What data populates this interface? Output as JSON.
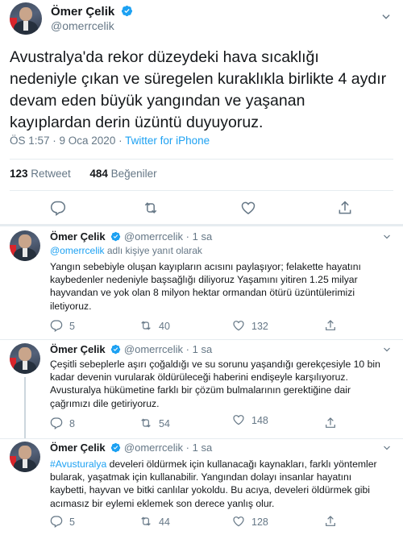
{
  "main": {
    "name": "Ömer Çelik",
    "handle": "@omerrcelik",
    "text": "Avustralya'da rekor düzeydeki hava sıcaklığı nedeniyle çıkan ve süregelen kuraklıkla birlikte 4 aydır devam eden büyük yangından ve yaşanan kayıplardan derin üzüntü duyuyoruz.",
    "time": "ÖS 1:57 · 9 Oca 2020 · ",
    "source": "Twitter for iPhone",
    "retweets": "123",
    "retweets_label": " Retweet",
    "likes": "484",
    "likes_label": " Beğeniler"
  },
  "replies": [
    {
      "name": "Ömer Çelik",
      "handle": "@omerrcelik",
      "time": " · 1 sa",
      "replying_mention": "@omerrcelik",
      "replying_rest": " adlı kişiye yanıt olarak",
      "text": "Yangın sebebiyle oluşan kayıpların acısını paylaşıyor; felakette hayatını kaybedenler nedeniyle başsağlığı diliyoruz Yaşamını yitiren 1.25 milyar hayvandan ve  yok olan 8 milyon hektar ormandan ötürü üzüntülerimizi iletiyoruz.",
      "replies": "5",
      "retweets": "40",
      "likes": "132"
    },
    {
      "name": "Ömer Çelik",
      "handle": "@omerrcelik",
      "time": " · 1 sa",
      "text": "Çeşitli sebeplerle aşırı çoğaldığı ve su sorunu yaşandığı gerekçesiyle 10 bin kadar devenin vurularak öldürüleceği haberini endişeyle karşılıyoruz. Avusturalya hükümetine farklı bir çözüm bulmalarının gerektiğine dair çağrımızı dile getiriyoruz.",
      "replies": "8",
      "retweets": "54",
      "likes": "148"
    },
    {
      "name": "Ömer Çelik",
      "handle": "@omerrcelik",
      "time": " · 1 sa",
      "hashtag": "#Avusturalya",
      "text": " develeri öldürmek için kullanacağı kaynakları, farklı yöntemler bularak, yaşatmak için kullanabilir. Yangından dolayı insanlar hayatını kaybetti, hayvan ve bitki canlılar yokoldu. Bu acıya, develeri öldürmek gibi acımasız bir eylemi eklemek son derece yanlış olur.",
      "replies": "5",
      "retweets": "44",
      "likes": "128"
    }
  ],
  "colors": {
    "accent": "#1da1f2",
    "muted": "#657786",
    "text": "#14171a",
    "border": "#e6ecf0"
  },
  "icons": [
    "verified-badge-icon",
    "chevron-down-icon",
    "reply-icon",
    "retweet-icon",
    "like-icon",
    "share-icon"
  ]
}
